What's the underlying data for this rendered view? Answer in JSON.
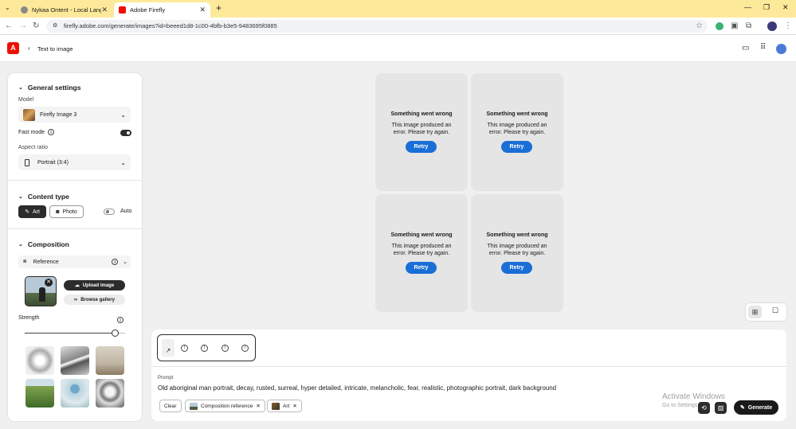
{
  "browser": {
    "tabs": [
      {
        "title": "Nykaa Ontent - Local Language"
      },
      {
        "title": "Adobe Firefly"
      }
    ],
    "new_tab": "+",
    "url": "firefly.adobe.com/generate/images?id=beeed1d8-1c00-4bfb-b3e5-9483695f0885"
  },
  "header": {
    "back_label": "Text to image",
    "logo": "A"
  },
  "sidebar": {
    "general": {
      "title": "General settings",
      "model_label": "Model",
      "model_value": "Firefly Image 3",
      "fast_mode_label": "Fast mode",
      "aspect_label": "Aspect ratio",
      "aspect_value": "Portrait (3:4)"
    },
    "content_type": {
      "title": "Content type",
      "art": "Art",
      "photo": "Photo",
      "auto": "Auto"
    },
    "composition": {
      "title": "Composition",
      "reference_label": "Reference",
      "upload": "Upload image",
      "browse": "Browse gallery",
      "strength_label": "Strength",
      "strength_value": 0.9
    }
  },
  "results": [
    {
      "title": "Something went wrong",
      "message": "This image produced an error. Please try again.",
      "retry": "Retry"
    },
    {
      "title": "Something went wrong",
      "message": "This image produced an error. Please try again.",
      "retry": "Retry"
    },
    {
      "title": "Something went wrong",
      "message": "This image produced an error. Please try again.",
      "retry": "Retry"
    },
    {
      "title": "Something went wrong",
      "message": "This image produced an error. Please try again.",
      "retry": "Retry"
    }
  ],
  "prompt": {
    "label": "Prompt",
    "text": "Old aboriginal man portrait, decay, rusted, surreal, hyper detailed, intricate, melancholic, fear, realistic, photographic portrait, dark background",
    "clear": "Clear",
    "chips": [
      "Composition reference",
      "Art"
    ],
    "generate": "Generate"
  },
  "watermark": {
    "line1": "Activate Windows",
    "line2": "Go to Settings to activate Windows."
  },
  "colors": {
    "accent": "#1a6fd6",
    "brand": "#eb1000",
    "tabbar": "#fde99a"
  }
}
